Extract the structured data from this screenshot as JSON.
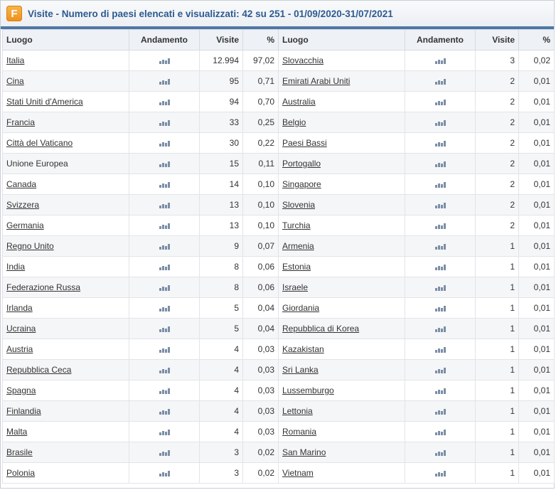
{
  "title": "Visite - Numero di paesi elencati e visualizzati: 42 su 251 - 01/09/2020-31/07/2021",
  "logo_letter": "F",
  "columns": {
    "luogo": "Luogo",
    "andamento": "Andamento",
    "visite": "Visite",
    "pct": "%"
  },
  "left_rows": [
    {
      "place": "Italia",
      "link": true,
      "visits": "12.994",
      "pct": "97,02"
    },
    {
      "place": "Cina",
      "link": true,
      "visits": "95",
      "pct": "0,71"
    },
    {
      "place": "Stati Uniti d'America",
      "link": true,
      "visits": "94",
      "pct": "0,70"
    },
    {
      "place": "Francia",
      "link": true,
      "visits": "33",
      "pct": "0,25"
    },
    {
      "place": "Città del Vaticano",
      "link": true,
      "visits": "30",
      "pct": "0,22"
    },
    {
      "place": "Unione Europea",
      "link": false,
      "visits": "15",
      "pct": "0,11"
    },
    {
      "place": "Canada",
      "link": true,
      "visits": "14",
      "pct": "0,10"
    },
    {
      "place": "Svizzera",
      "link": true,
      "visits": "13",
      "pct": "0,10"
    },
    {
      "place": "Germania",
      "link": true,
      "visits": "13",
      "pct": "0,10"
    },
    {
      "place": "Regno Unito",
      "link": true,
      "visits": "9",
      "pct": "0,07"
    },
    {
      "place": "India",
      "link": true,
      "visits": "8",
      "pct": "0,06"
    },
    {
      "place": "Federazione Russa",
      "link": true,
      "visits": "8",
      "pct": "0,06"
    },
    {
      "place": "Irlanda",
      "link": true,
      "visits": "5",
      "pct": "0,04"
    },
    {
      "place": "Ucraina",
      "link": true,
      "visits": "5",
      "pct": "0,04"
    },
    {
      "place": "Austria",
      "link": true,
      "visits": "4",
      "pct": "0,03"
    },
    {
      "place": "Repubblica Ceca",
      "link": true,
      "visits": "4",
      "pct": "0,03"
    },
    {
      "place": "Spagna",
      "link": true,
      "visits": "4",
      "pct": "0,03"
    },
    {
      "place": "Finlandia",
      "link": true,
      "visits": "4",
      "pct": "0,03"
    },
    {
      "place": "Malta",
      "link": true,
      "visits": "4",
      "pct": "0,03"
    },
    {
      "place": "Brasile",
      "link": true,
      "visits": "3",
      "pct": "0,02"
    },
    {
      "place": "Polonia",
      "link": true,
      "visits": "3",
      "pct": "0,02"
    }
  ],
  "right_rows": [
    {
      "place": "Slovacchia",
      "link": true,
      "visits": "3",
      "pct": "0,02"
    },
    {
      "place": "Emirati Arabi Uniti",
      "link": true,
      "visits": "2",
      "pct": "0,01"
    },
    {
      "place": "Australia",
      "link": true,
      "visits": "2",
      "pct": "0,01"
    },
    {
      "place": "Belgio",
      "link": true,
      "visits": "2",
      "pct": "0,01"
    },
    {
      "place": "Paesi Bassi",
      "link": true,
      "visits": "2",
      "pct": "0,01"
    },
    {
      "place": "Portogallo",
      "link": true,
      "visits": "2",
      "pct": "0,01"
    },
    {
      "place": "Singapore",
      "link": true,
      "visits": "2",
      "pct": "0,01"
    },
    {
      "place": "Slovenia",
      "link": true,
      "visits": "2",
      "pct": "0,01"
    },
    {
      "place": "Turchia",
      "link": true,
      "visits": "2",
      "pct": "0,01"
    },
    {
      "place": "Armenia",
      "link": true,
      "visits": "1",
      "pct": "0,01"
    },
    {
      "place": "Estonia",
      "link": true,
      "visits": "1",
      "pct": "0,01"
    },
    {
      "place": "Israele",
      "link": true,
      "visits": "1",
      "pct": "0,01"
    },
    {
      "place": "Giordania",
      "link": true,
      "visits": "1",
      "pct": "0,01"
    },
    {
      "place": "Repubblica di Korea",
      "link": true,
      "visits": "1",
      "pct": "0,01"
    },
    {
      "place": "Kazakistan",
      "link": true,
      "visits": "1",
      "pct": "0,01"
    },
    {
      "place": "Sri Lanka",
      "link": true,
      "visits": "1",
      "pct": "0,01"
    },
    {
      "place": "Lussemburgo",
      "link": true,
      "visits": "1",
      "pct": "0,01"
    },
    {
      "place": "Lettonia",
      "link": true,
      "visits": "1",
      "pct": "0,01"
    },
    {
      "place": "Romania",
      "link": true,
      "visits": "1",
      "pct": "0,01"
    },
    {
      "place": "San Marino",
      "link": true,
      "visits": "1",
      "pct": "0,01"
    },
    {
      "place": "Vietnam",
      "link": true,
      "visits": "1",
      "pct": "0,01"
    }
  ],
  "icons": {
    "logo": "flag-counter-logo-icon",
    "trend": "trend-bars-icon"
  },
  "colors": {
    "title": "#2d5a91",
    "header_border": "#4f77a6",
    "logo": "#ee8f1b",
    "trend_bars": "#7b8ea7"
  }
}
